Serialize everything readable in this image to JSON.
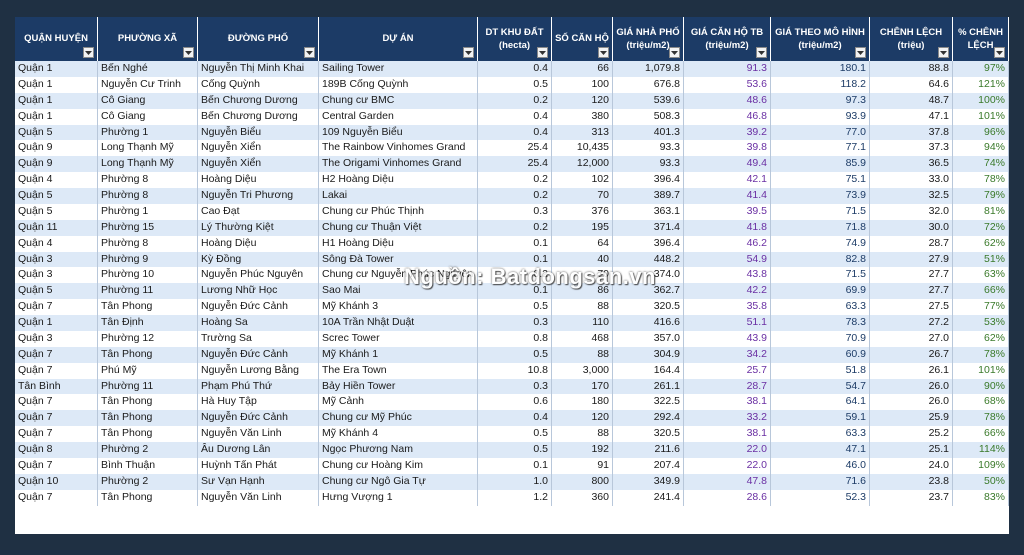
{
  "headers": [
    {
      "l1": "QUẬN HUYỆN",
      "l2": ""
    },
    {
      "l1": "PHƯỜNG XÃ",
      "l2": ""
    },
    {
      "l1": "ĐƯỜNG PHỐ",
      "l2": ""
    },
    {
      "l1": "DỰ ÁN",
      "l2": ""
    },
    {
      "l1": "DT KHU ĐẤT",
      "l2": "(hecta)"
    },
    {
      "l1": "SỐ CĂN HỘ",
      "l2": ""
    },
    {
      "l1": "GIÁ NHÀ PHỐ",
      "l2": "(triệu/m2)"
    },
    {
      "l1": "GIÁ CĂN HỘ TB",
      "l2": "(triệu/m2)"
    },
    {
      "l1": "GIÁ THEO MÔ HÌNH",
      "l2": "(triệu/m2)"
    },
    {
      "l1": "CHÊNH LỆCH",
      "l2": "(triệu)"
    },
    {
      "l1": "% CHÊNH",
      "l2": "LỆCH"
    }
  ],
  "rows": [
    [
      "Quận 1",
      "Bến Nghé",
      "Nguyễn Thị Minh Khai",
      "Sailing Tower",
      "0.4",
      "66",
      "1,079.8",
      "91.3",
      "180.1",
      "88.8",
      "97%"
    ],
    [
      "Quận 1",
      "Nguyễn Cư Trinh",
      "Cống Quỳnh",
      "189B Cống Quỳnh",
      "0.5",
      "100",
      "676.8",
      "53.6",
      "118.2",
      "64.6",
      "121%"
    ],
    [
      "Quận 1",
      "Cô Giang",
      "Bến Chương Dương",
      "Chung cư BMC",
      "0.2",
      "120",
      "539.6",
      "48.6",
      "97.3",
      "48.7",
      "100%"
    ],
    [
      "Quận 1",
      "Cô Giang",
      "Bến Chương Dương",
      "Central Garden",
      "0.4",
      "380",
      "508.3",
      "46.8",
      "93.9",
      "47.1",
      "101%"
    ],
    [
      "Quận 5",
      "Phường 1",
      "Nguyễn Biểu",
      "109 Nguyễn Biểu",
      "0.4",
      "313",
      "401.3",
      "39.2",
      "77.0",
      "37.8",
      "96%"
    ],
    [
      "Quận 9",
      "Long Thạnh Mỹ",
      "Nguyễn Xiển",
      "The Rainbow Vinhomes Grand",
      "25.4",
      "10,435",
      "93.3",
      "39.8",
      "77.1",
      "37.3",
      "94%"
    ],
    [
      "Quận 9",
      "Long Thạnh Mỹ",
      "Nguyễn Xiển",
      "The Origami Vinhomes Grand",
      "25.4",
      "12,000",
      "93.3",
      "49.4",
      "85.9",
      "36.5",
      "74%"
    ],
    [
      "Quận 4",
      "Phường 8",
      "Hoàng Diệu",
      "H2 Hoàng Diệu",
      "0.2",
      "102",
      "396.4",
      "42.1",
      "75.1",
      "33.0",
      "78%"
    ],
    [
      "Quận 5",
      "Phường 8",
      "Nguyễn Tri Phương",
      "Lakai",
      "0.2",
      "70",
      "389.7",
      "41.4",
      "73.9",
      "32.5",
      "79%"
    ],
    [
      "Quận 5",
      "Phường 1",
      "Cao Đạt",
      "Chung cư Phúc Thịnh",
      "0.3",
      "376",
      "363.1",
      "39.5",
      "71.5",
      "32.0",
      "81%"
    ],
    [
      "Quận 11",
      "Phường 15",
      "Lý Thường Kiệt",
      "Chung cư Thuận Việt",
      "0.2",
      "195",
      "371.4",
      "41.8",
      "71.8",
      "30.0",
      "72%"
    ],
    [
      "Quận 4",
      "Phường 8",
      "Hoàng Diệu",
      "H1 Hoàng Diệu",
      "0.1",
      "64",
      "396.4",
      "46.2",
      "74.9",
      "28.7",
      "62%"
    ],
    [
      "Quận 3",
      "Phường 9",
      "Kỳ Đồng",
      "Sông Đà Tower",
      "0.1",
      "40",
      "448.2",
      "54.9",
      "82.8",
      "27.9",
      "51%"
    ],
    [
      "Quận 3",
      "Phường 10",
      "Nguyễn Phúc Nguyên",
      "Chung cư Nguyễn Phúc Nguyên",
      "0.2",
      "70",
      "374.0",
      "43.8",
      "71.5",
      "27.7",
      "63%"
    ],
    [
      "Quận 5",
      "Phường 11",
      "Lương Nhữ Học",
      "Sao Mai",
      "0.1",
      "86",
      "362.7",
      "42.2",
      "69.9",
      "27.7",
      "66%"
    ],
    [
      "Quận 7",
      "Tân Phong",
      "Nguyễn Đức Cảnh",
      "Mỹ Khánh 3",
      "0.5",
      "88",
      "320.5",
      "35.8",
      "63.3",
      "27.5",
      "77%"
    ],
    [
      "Quận 1",
      "Tân Định",
      "Hoàng Sa",
      "10A Trần Nhật Duật",
      "0.3",
      "110",
      "416.6",
      "51.1",
      "78.3",
      "27.2",
      "53%"
    ],
    [
      "Quận 3",
      "Phường 12",
      "Trường Sa",
      "Screc Tower",
      "0.8",
      "468",
      "357.0",
      "43.9",
      "70.9",
      "27.0",
      "62%"
    ],
    [
      "Quận 7",
      "Tân Phong",
      "Nguyễn Đức Cảnh",
      "Mỹ Khánh 1",
      "0.5",
      "88",
      "304.9",
      "34.2",
      "60.9",
      "26.7",
      "78%"
    ],
    [
      "Quận 7",
      "Phú Mỹ",
      "Nguyễn Lương Bằng",
      "The Era Town",
      "10.8",
      "3,000",
      "164.4",
      "25.7",
      "51.8",
      "26.1",
      "101%"
    ],
    [
      "Tân Bình",
      "Phường 11",
      "Phạm Phú Thứ",
      "Bảy Hiền Tower",
      "0.3",
      "170",
      "261.1",
      "28.7",
      "54.7",
      "26.0",
      "90%"
    ],
    [
      "Quận 7",
      "Tân Phong",
      "Hà Huy Tập",
      "Mỹ Cảnh",
      "0.6",
      "180",
      "322.5",
      "38.1",
      "64.1",
      "26.0",
      "68%"
    ],
    [
      "Quận 7",
      "Tân Phong",
      "Nguyễn Đức Cảnh",
      "Chung cư Mỹ Phúc",
      "0.4",
      "120",
      "292.4",
      "33.2",
      "59.1",
      "25.9",
      "78%"
    ],
    [
      "Quận 7",
      "Tân Phong",
      "Nguyễn Văn Linh",
      "Mỹ Khánh 4",
      "0.5",
      "88",
      "320.5",
      "38.1",
      "63.3",
      "25.2",
      "66%"
    ],
    [
      "Quận 8",
      "Phường 2",
      "Âu Dương Lân",
      "Ngọc Phương Nam",
      "0.5",
      "192",
      "211.6",
      "22.0",
      "47.1",
      "25.1",
      "114%"
    ],
    [
      "Quận 7",
      "Bình Thuận",
      "Huỳnh Tấn Phát",
      "Chung cư Hoàng Kim",
      "0.1",
      "91",
      "207.4",
      "22.0",
      "46.0",
      "24.0",
      "109%"
    ],
    [
      "Quận 10",
      "Phường 2",
      "Sư Vạn Hạnh",
      "Chung cư Ngô Gia Tự",
      "1.0",
      "800",
      "349.9",
      "47.8",
      "71.6",
      "23.8",
      "50%"
    ],
    [
      "Quận 7",
      "Tân Phong",
      "Nguyễn Văn Linh",
      "Hưng Vượng 1",
      "1.2",
      "360",
      "241.4",
      "28.6",
      "52.3",
      "23.7",
      "83%"
    ]
  ],
  "watermark": "Nguồn: Batdongsan.vn",
  "colors": {
    "header_bg": "#1c3b66",
    "purple": "#6a2fa3",
    "navy": "#1c3b66",
    "green": "#3a7a2a",
    "row_alt": "#dde9f7"
  }
}
